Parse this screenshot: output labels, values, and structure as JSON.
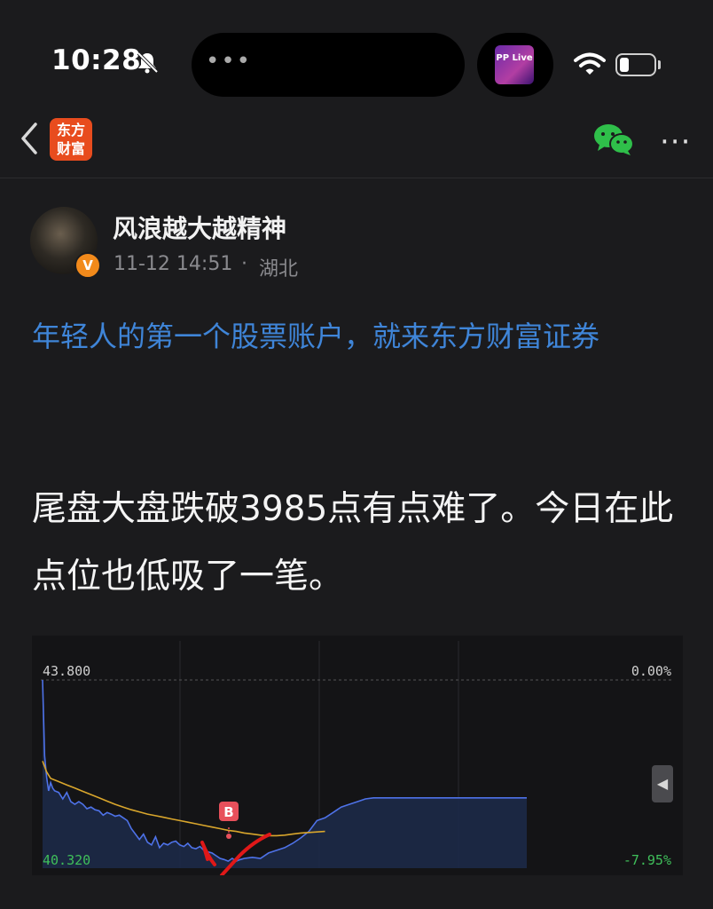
{
  "status_bar": {
    "time": "10:28",
    "island_dots": "•••",
    "live_badge": "PP Live"
  },
  "header": {
    "logo": "东方财富"
  },
  "post": {
    "author": "风浪越大越精神",
    "verified_badge": "V",
    "time": "11-12 14:51",
    "dot": "·",
    "location": "湖北",
    "promo_link": "年轻人的第一个股票账户，就来东方财富证券",
    "body": "尾盘大盘跌破3985点有点难了。今日在此点位也低吸了一笔。"
  },
  "chart_data": {
    "type": "line",
    "y_left_top": "43.800",
    "y_left_bottom": "40.320",
    "y_right_top": "0.00%",
    "y_right_bottom": "-7.95%",
    "ylim": [
      40.32,
      43.8
    ],
    "marker_label": "B",
    "series": [
      {
        "color": "#4e72e8",
        "x": [
          0,
          1,
          2,
          3,
          4,
          5,
          6,
          8,
          10,
          12,
          14,
          16,
          18,
          20,
          22,
          24,
          26,
          28,
          30,
          32,
          34,
          36,
          38,
          40,
          42,
          44,
          46,
          48,
          50,
          52,
          54,
          56,
          58,
          60,
          62,
          64,
          66,
          68,
          70,
          72,
          74,
          76,
          78,
          80,
          82,
          84,
          86,
          88,
          90,
          92,
          94,
          96,
          98,
          100,
          104,
          108,
          112,
          116,
          120,
          124,
          128,
          132,
          136,
          140,
          144,
          148,
          152,
          156,
          160,
          164,
          168,
          172,
          176,
          180,
          184,
          188,
          192,
          196,
          200,
          204,
          208,
          212,
          216,
          220,
          224,
          228,
          232,
          236,
          240
        ],
        "values": [
          43.8,
          42.4,
          42.0,
          41.75,
          41.9,
          41.8,
          41.75,
          41.72,
          41.6,
          41.72,
          41.55,
          41.5,
          41.55,
          41.5,
          41.42,
          41.45,
          41.4,
          41.38,
          41.3,
          41.35,
          41.32,
          41.28,
          41.3,
          41.25,
          41.2,
          41.05,
          40.95,
          40.85,
          40.95,
          40.8,
          40.75,
          40.9,
          40.7,
          40.78,
          40.75,
          40.8,
          40.82,
          40.75,
          40.72,
          40.78,
          40.7,
          40.68,
          40.72,
          40.65,
          40.62,
          40.6,
          40.55,
          40.5,
          40.48,
          40.45,
          40.5,
          40.45,
          40.48,
          40.5,
          40.52,
          40.5,
          40.6,
          40.65,
          40.7,
          40.78,
          40.88,
          41.0,
          41.2,
          41.25,
          41.35,
          41.45,
          41.5,
          41.55,
          41.6,
          41.62,
          41.62,
          41.62,
          41.62,
          41.62,
          41.62,
          41.62,
          41.62,
          41.62,
          41.62,
          41.62,
          41.62,
          41.62,
          41.62,
          41.62,
          41.62,
          41.62,
          41.62,
          41.62,
          41.62
        ]
      },
      {
        "color": "#d9a62c",
        "x": [
          0,
          2,
          4,
          8,
          12,
          16,
          20,
          24,
          28,
          32,
          36,
          40,
          44,
          48,
          52,
          56,
          60,
          64,
          68,
          72,
          76,
          80,
          84,
          88,
          92,
          96,
          100,
          104,
          108,
          112,
          116,
          120,
          124,
          128,
          132,
          136,
          140
        ],
        "values": [
          42.3,
          42.1,
          41.98,
          41.92,
          41.86,
          41.8,
          41.74,
          41.68,
          41.62,
          41.56,
          41.5,
          41.45,
          41.4,
          41.36,
          41.32,
          41.29,
          41.26,
          41.23,
          41.2,
          41.17,
          41.14,
          41.11,
          41.08,
          41.05,
          41.02,
          41.0,
          40.97,
          40.95,
          40.93,
          40.92,
          40.92,
          40.93,
          40.95,
          40.97,
          40.98,
          40.99,
          41.0
        ]
      }
    ]
  }
}
